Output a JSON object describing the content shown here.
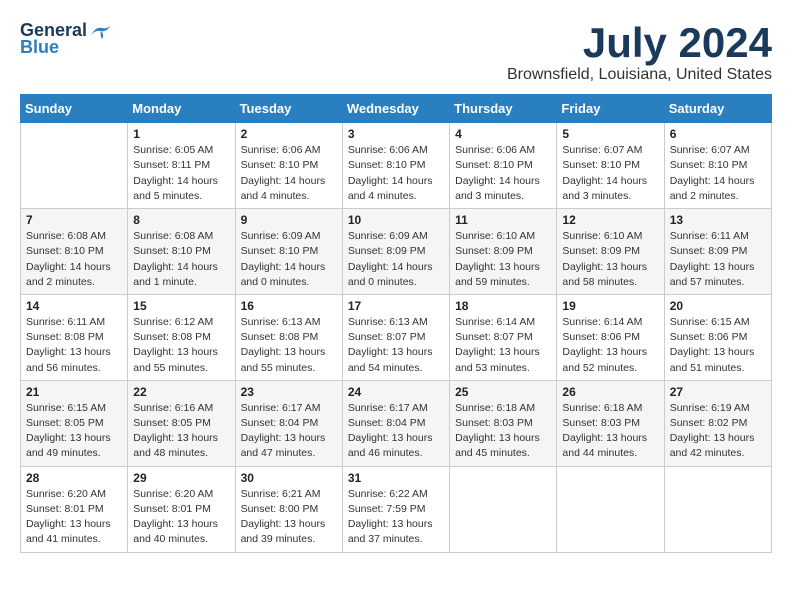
{
  "header": {
    "logo": {
      "general": "General",
      "blue": "Blue"
    },
    "title": "July 2024",
    "location": "Brownsfield, Louisiana, United States"
  },
  "weekdays": [
    "Sunday",
    "Monday",
    "Tuesday",
    "Wednesday",
    "Thursday",
    "Friday",
    "Saturday"
  ],
  "weeks": [
    [
      {
        "day": "",
        "info": ""
      },
      {
        "day": "1",
        "info": "Sunrise: 6:05 AM\nSunset: 8:11 PM\nDaylight: 14 hours\nand 5 minutes."
      },
      {
        "day": "2",
        "info": "Sunrise: 6:06 AM\nSunset: 8:10 PM\nDaylight: 14 hours\nand 4 minutes."
      },
      {
        "day": "3",
        "info": "Sunrise: 6:06 AM\nSunset: 8:10 PM\nDaylight: 14 hours\nand 4 minutes."
      },
      {
        "day": "4",
        "info": "Sunrise: 6:06 AM\nSunset: 8:10 PM\nDaylight: 14 hours\nand 3 minutes."
      },
      {
        "day": "5",
        "info": "Sunrise: 6:07 AM\nSunset: 8:10 PM\nDaylight: 14 hours\nand 3 minutes."
      },
      {
        "day": "6",
        "info": "Sunrise: 6:07 AM\nSunset: 8:10 PM\nDaylight: 14 hours\nand 2 minutes."
      }
    ],
    [
      {
        "day": "7",
        "info": "Sunrise: 6:08 AM\nSunset: 8:10 PM\nDaylight: 14 hours\nand 2 minutes."
      },
      {
        "day": "8",
        "info": "Sunrise: 6:08 AM\nSunset: 8:10 PM\nDaylight: 14 hours\nand 1 minute."
      },
      {
        "day": "9",
        "info": "Sunrise: 6:09 AM\nSunset: 8:10 PM\nDaylight: 14 hours\nand 0 minutes."
      },
      {
        "day": "10",
        "info": "Sunrise: 6:09 AM\nSunset: 8:09 PM\nDaylight: 14 hours\nand 0 minutes."
      },
      {
        "day": "11",
        "info": "Sunrise: 6:10 AM\nSunset: 8:09 PM\nDaylight: 13 hours\nand 59 minutes."
      },
      {
        "day": "12",
        "info": "Sunrise: 6:10 AM\nSunset: 8:09 PM\nDaylight: 13 hours\nand 58 minutes."
      },
      {
        "day": "13",
        "info": "Sunrise: 6:11 AM\nSunset: 8:09 PM\nDaylight: 13 hours\nand 57 minutes."
      }
    ],
    [
      {
        "day": "14",
        "info": "Sunrise: 6:11 AM\nSunset: 8:08 PM\nDaylight: 13 hours\nand 56 minutes."
      },
      {
        "day": "15",
        "info": "Sunrise: 6:12 AM\nSunset: 8:08 PM\nDaylight: 13 hours\nand 55 minutes."
      },
      {
        "day": "16",
        "info": "Sunrise: 6:13 AM\nSunset: 8:08 PM\nDaylight: 13 hours\nand 55 minutes."
      },
      {
        "day": "17",
        "info": "Sunrise: 6:13 AM\nSunset: 8:07 PM\nDaylight: 13 hours\nand 54 minutes."
      },
      {
        "day": "18",
        "info": "Sunrise: 6:14 AM\nSunset: 8:07 PM\nDaylight: 13 hours\nand 53 minutes."
      },
      {
        "day": "19",
        "info": "Sunrise: 6:14 AM\nSunset: 8:06 PM\nDaylight: 13 hours\nand 52 minutes."
      },
      {
        "day": "20",
        "info": "Sunrise: 6:15 AM\nSunset: 8:06 PM\nDaylight: 13 hours\nand 51 minutes."
      }
    ],
    [
      {
        "day": "21",
        "info": "Sunrise: 6:15 AM\nSunset: 8:05 PM\nDaylight: 13 hours\nand 49 minutes."
      },
      {
        "day": "22",
        "info": "Sunrise: 6:16 AM\nSunset: 8:05 PM\nDaylight: 13 hours\nand 48 minutes."
      },
      {
        "day": "23",
        "info": "Sunrise: 6:17 AM\nSunset: 8:04 PM\nDaylight: 13 hours\nand 47 minutes."
      },
      {
        "day": "24",
        "info": "Sunrise: 6:17 AM\nSunset: 8:04 PM\nDaylight: 13 hours\nand 46 minutes."
      },
      {
        "day": "25",
        "info": "Sunrise: 6:18 AM\nSunset: 8:03 PM\nDaylight: 13 hours\nand 45 minutes."
      },
      {
        "day": "26",
        "info": "Sunrise: 6:18 AM\nSunset: 8:03 PM\nDaylight: 13 hours\nand 44 minutes."
      },
      {
        "day": "27",
        "info": "Sunrise: 6:19 AM\nSunset: 8:02 PM\nDaylight: 13 hours\nand 42 minutes."
      }
    ],
    [
      {
        "day": "28",
        "info": "Sunrise: 6:20 AM\nSunset: 8:01 PM\nDaylight: 13 hours\nand 41 minutes."
      },
      {
        "day": "29",
        "info": "Sunrise: 6:20 AM\nSunset: 8:01 PM\nDaylight: 13 hours\nand 40 minutes."
      },
      {
        "day": "30",
        "info": "Sunrise: 6:21 AM\nSunset: 8:00 PM\nDaylight: 13 hours\nand 39 minutes."
      },
      {
        "day": "31",
        "info": "Sunrise: 6:22 AM\nSunset: 7:59 PM\nDaylight: 13 hours\nand 37 minutes."
      },
      {
        "day": "",
        "info": ""
      },
      {
        "day": "",
        "info": ""
      },
      {
        "day": "",
        "info": ""
      }
    ]
  ]
}
